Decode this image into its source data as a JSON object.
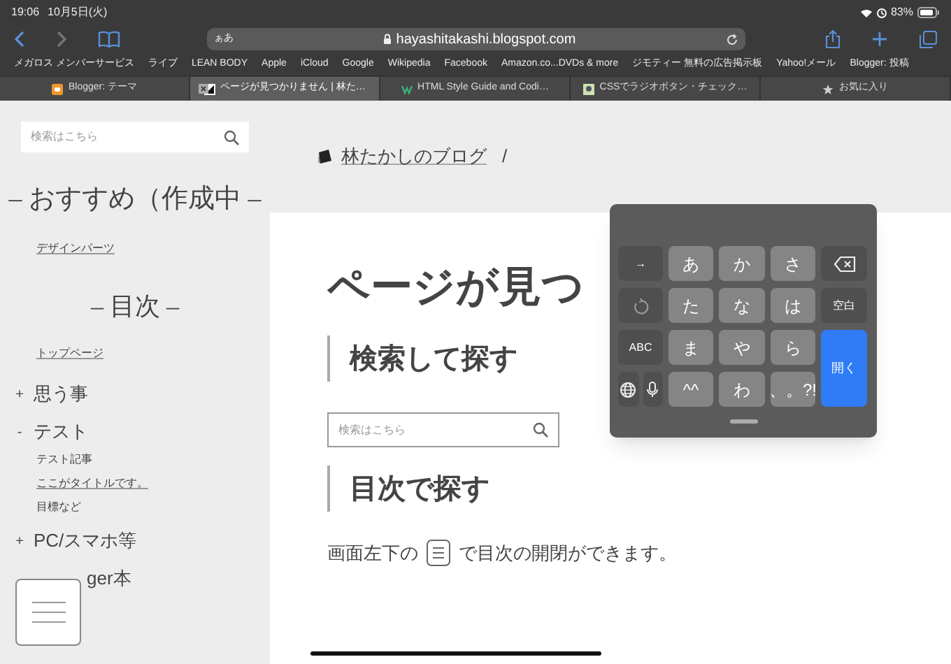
{
  "status_bar": {
    "time": "19:06",
    "date": "10月5日(火)",
    "battery": "83%"
  },
  "nav": {
    "back_enabled": true,
    "forward_enabled": false
  },
  "address_bar": {
    "text_size": "ぁあ",
    "url": "hayashitakashi.blogspot.com"
  },
  "bookmarks": [
    "メガロス メンバーサービス",
    "ライブ",
    "LEAN BODY",
    "Apple",
    "iCloud",
    "Google",
    "Wikipedia",
    "Facebook",
    "Amazon.co...DVDs & more",
    "ジモティー 無料の広告掲示板",
    "Yahoo!メール",
    "Blogger: 投稿"
  ],
  "tabs": [
    {
      "kind": "blogger",
      "label": "Blogger: テーマ",
      "selected": false
    },
    {
      "kind": "page",
      "label": "ページが見つかりません | 林た…",
      "selected": true
    },
    {
      "kind": "html",
      "label": "HTML Style Guide and Codi…",
      "selected": false
    },
    {
      "kind": "css",
      "label": "CSSでラジオボタン・チェック…",
      "selected": false
    },
    {
      "kind": "favorites",
      "label": "お気に入り",
      "selected": false
    }
  ],
  "sidebar": {
    "search_placeholder": "検索はこちら",
    "recommend_heading": "– おすすめ（作成中 –",
    "recommend_links": [
      "デザインパーツ"
    ],
    "toc_heading": "– 目次 –",
    "toc_links": [
      "トップページ"
    ],
    "tree": [
      {
        "toggle": "+",
        "label": "思う事"
      },
      {
        "toggle": "-",
        "label": "テスト",
        "children": [
          {
            "label": "テスト記事",
            "link": false
          },
          {
            "label": "ここがタイトルです。",
            "link": true
          },
          {
            "label": "目標など",
            "link": false
          }
        ]
      },
      {
        "toggle": "+",
        "label": "PC/スマホ等"
      },
      {
        "label": "ger本"
      }
    ]
  },
  "main": {
    "breadcrumb": "林たかしのブログ",
    "separator": "/",
    "title": "ページが見つ",
    "search_heading": "検索して探す",
    "search_placeholder": "検索はこちら",
    "toc_heading": "目次で探す",
    "hint_before": "画面左下の",
    "hint_after": "で目次の開閉ができます。"
  },
  "keyboard": {
    "rows": [
      [
        {
          "kind": "function",
          "label": "→"
        },
        {
          "kind": "char",
          "label": "あ"
        },
        {
          "kind": "char",
          "label": "か"
        },
        {
          "kind": "char",
          "label": "さ"
        },
        {
          "kind": "delete"
        }
      ],
      [
        {
          "kind": "undo"
        },
        {
          "kind": "char",
          "label": "た"
        },
        {
          "kind": "char",
          "label": "な"
        },
        {
          "kind": "char",
          "label": "は"
        },
        {
          "kind": "function",
          "label": "空白"
        }
      ],
      [
        {
          "kind": "function",
          "label": "ABC"
        },
        {
          "kind": "char",
          "label": "ま"
        },
        {
          "kind": "char",
          "label": "や"
        },
        {
          "kind": "char",
          "label": "ら"
        },
        {
          "kind": "enter",
          "label": "開く"
        }
      ],
      [
        {
          "kind": "pair",
          "keys": [
            {
              "kind": "globe"
            },
            {
              "kind": "mic"
            }
          ]
        },
        {
          "kind": "char",
          "label": "^^"
        },
        {
          "kind": "char",
          "label": "わ"
        },
        {
          "kind": "char",
          "label": "、。?!"
        }
      ]
    ]
  }
}
